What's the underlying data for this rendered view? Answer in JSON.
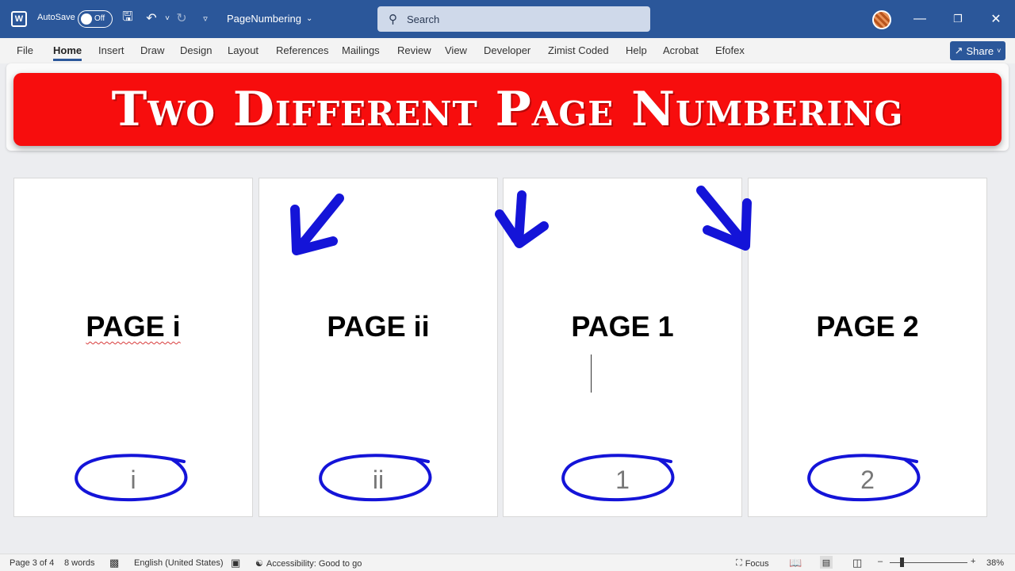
{
  "titlebar": {
    "logo": "W",
    "autosave_label": "AutoSave",
    "autosave_state": "Off",
    "doc_title": "PageNumbering",
    "search_placeholder": "Search"
  },
  "tabs": [
    {
      "label": "File"
    },
    {
      "label": "Home"
    },
    {
      "label": "Insert"
    },
    {
      "label": "Draw"
    },
    {
      "label": "Design"
    },
    {
      "label": "Layout"
    },
    {
      "label": "References"
    },
    {
      "label": "Mailings"
    },
    {
      "label": "Review"
    },
    {
      "label": "View"
    },
    {
      "label": "Developer"
    },
    {
      "label": "Zimist Coded"
    },
    {
      "label": "Help"
    },
    {
      "label": "Acrobat"
    },
    {
      "label": "Efofex"
    }
  ],
  "share_label": "Share",
  "banner_text": "Two Different Page Numbering",
  "pages": [
    {
      "heading": "PAGE i",
      "number": "i"
    },
    {
      "heading": "PAGE ii",
      "number": "ii"
    },
    {
      "heading": "PAGE 1",
      "number": "1"
    },
    {
      "heading": "PAGE 2",
      "number": "2"
    }
  ],
  "status": {
    "page": "Page 3 of 4",
    "words": "8 words",
    "language": "English (United States)",
    "accessibility": "Accessibility: Good to go",
    "focus": "Focus",
    "zoom": "38%"
  },
  "colors": {
    "titlebar": "#2b579a",
    "banner": "#f70d0d",
    "annotation": "#1414d8"
  }
}
